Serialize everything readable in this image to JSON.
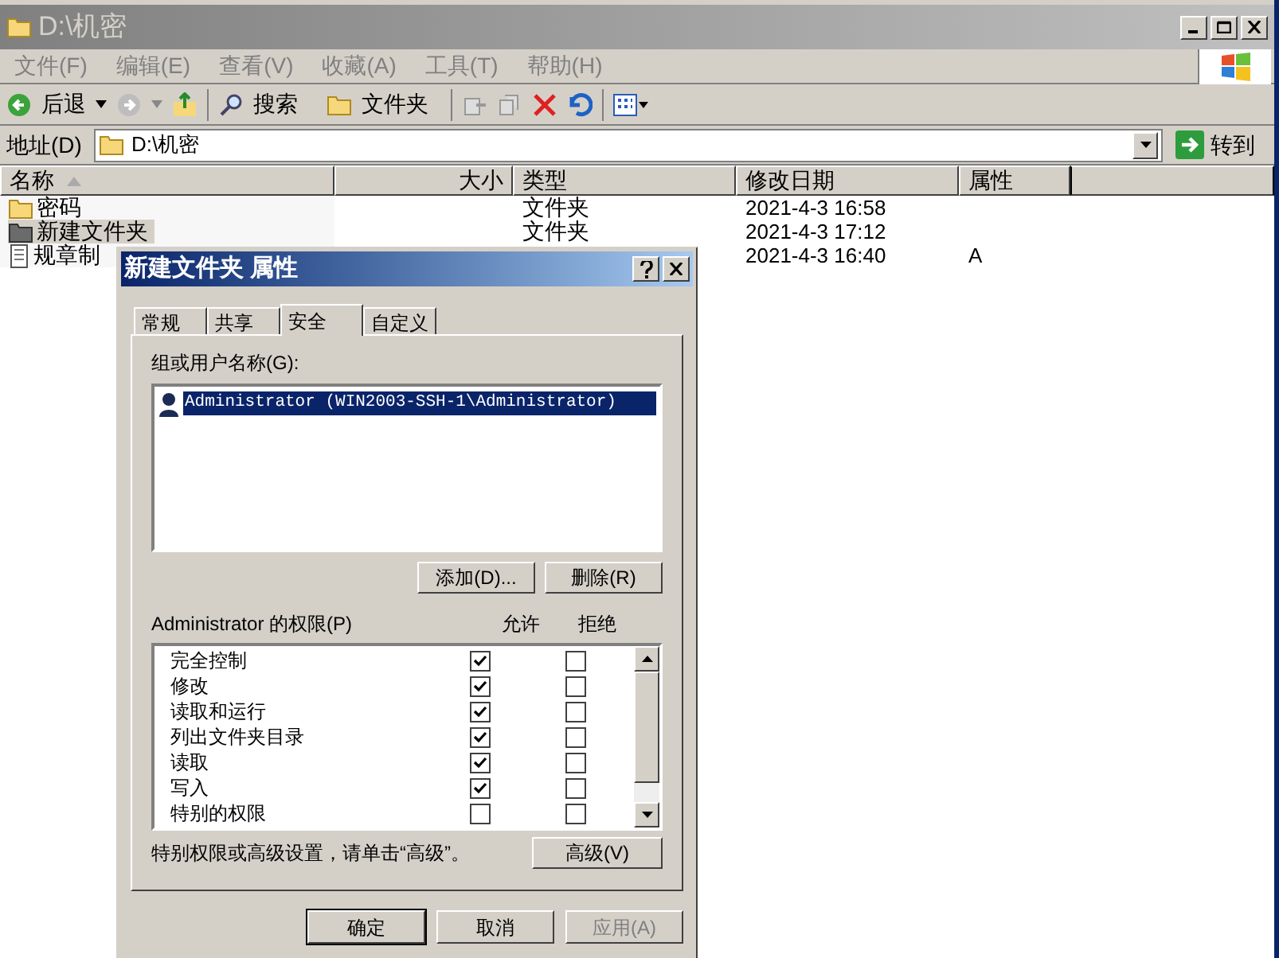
{
  "explorer": {
    "title": "D:\\机密",
    "menu": [
      "文件(F)",
      "编辑(E)",
      "查看(V)",
      "收藏(A)",
      "工具(T)",
      "帮助(H)"
    ],
    "toolbar": {
      "back": "后退",
      "search": "搜索",
      "folders": "文件夹"
    },
    "address": {
      "label": "地址(D)",
      "value": "D:\\机密",
      "go": "转到"
    },
    "columns": [
      "名称",
      "大小",
      "类型",
      "修改日期",
      "属性"
    ],
    "rows": [
      {
        "kind": "folder",
        "name": "密码",
        "type": "文件夹",
        "modified": "2021-4-3 16:58",
        "selected": false
      },
      {
        "kind": "folder",
        "name": "新建文件夹",
        "type": "文件夹",
        "modified": "2021-4-3 17:12",
        "selected": true
      },
      {
        "kind": "file",
        "name": "规章制",
        "modified": "2021-4-3 16:40",
        "attributes": "A",
        "selected": false
      }
    ]
  },
  "dialog": {
    "title": "新建文件夹 属性",
    "tabs": [
      {
        "label": "常规",
        "selected": false
      },
      {
        "label": "共享",
        "selected": false
      },
      {
        "label": "安全",
        "selected": true
      },
      {
        "label": "自定义",
        "selected": false
      }
    ],
    "users_label": "组或用户名称(G):",
    "users": [
      {
        "name": "Administrator (WIN2003-SSH-1\\Administrator)",
        "selected": true
      }
    ],
    "add": "添加(D)...",
    "remove": "删除(R)",
    "permissions_label": "Administrator 的权限(P)",
    "allow_label": "允许",
    "deny_label": "拒绝",
    "permissions": [
      {
        "name": "完全控制",
        "allow": true,
        "deny": false
      },
      {
        "name": "修改",
        "allow": true,
        "deny": false
      },
      {
        "name": "读取和运行",
        "allow": true,
        "deny": false
      },
      {
        "name": "列出文件夹目录",
        "allow": true,
        "deny": false
      },
      {
        "name": "读取",
        "allow": true,
        "deny": false
      },
      {
        "name": "写入",
        "allow": true,
        "deny": false
      },
      {
        "name": "特别的权限",
        "allow": false,
        "deny": false
      }
    ],
    "note": "特别权限或高级设置，请单击“高级”。",
    "advanced": "高级(V)",
    "buttons": [
      {
        "label": "确定",
        "disabled": false
      },
      {
        "label": "取消",
        "disabled": false
      },
      {
        "label": "应用(A)",
        "disabled": true
      }
    ]
  }
}
